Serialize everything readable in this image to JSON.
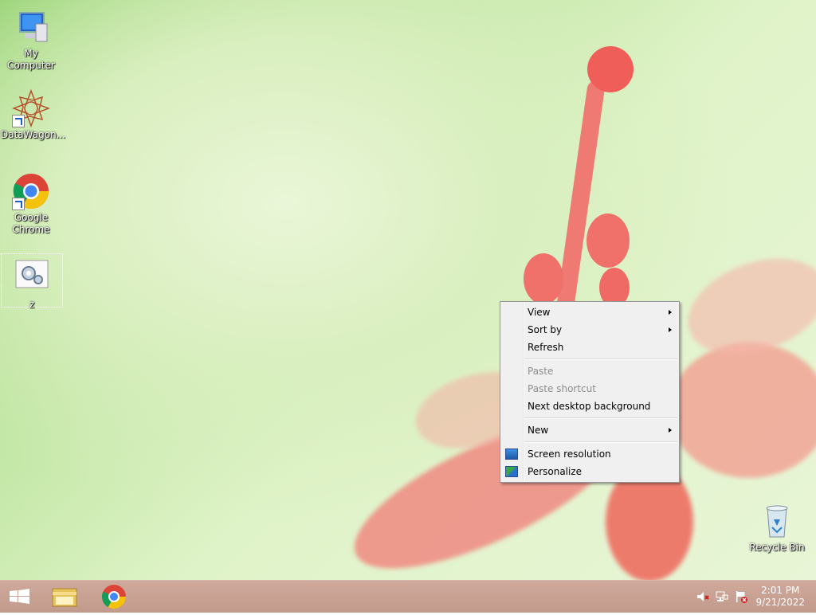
{
  "desktop": {
    "icons": [
      {
        "label": "My Computer",
        "icon": "computer-icon"
      },
      {
        "label": "DataWagon...",
        "icon": "datawagon-icon"
      },
      {
        "label": "Google Chrome",
        "icon": "chrome-icon"
      },
      {
        "label": "z",
        "icon": "settings-file-icon"
      },
      {
        "label": "Recycle Bin",
        "icon": "recycle-bin-icon"
      }
    ]
  },
  "context_menu": {
    "items": [
      {
        "label": "View",
        "submenu": true
      },
      {
        "label": "Sort by",
        "submenu": true
      },
      {
        "label": "Refresh"
      },
      {
        "label": "Paste",
        "disabled": true
      },
      {
        "label": "Paste shortcut",
        "disabled": true
      },
      {
        "label": "Next desktop background"
      },
      {
        "label": "New",
        "submenu": true
      },
      {
        "label": "Screen resolution",
        "icon": "screen-resolution-icon"
      },
      {
        "label": "Personalize",
        "icon": "personalize-icon"
      }
    ]
  },
  "taskbar": {
    "pinned": [
      "start-icon",
      "file-explorer-icon",
      "chrome-icon"
    ],
    "tray": [
      "volume-muted-icon",
      "network-icon",
      "action-center-icon"
    ],
    "time": "2:01 PM",
    "date": "9/21/2022"
  }
}
